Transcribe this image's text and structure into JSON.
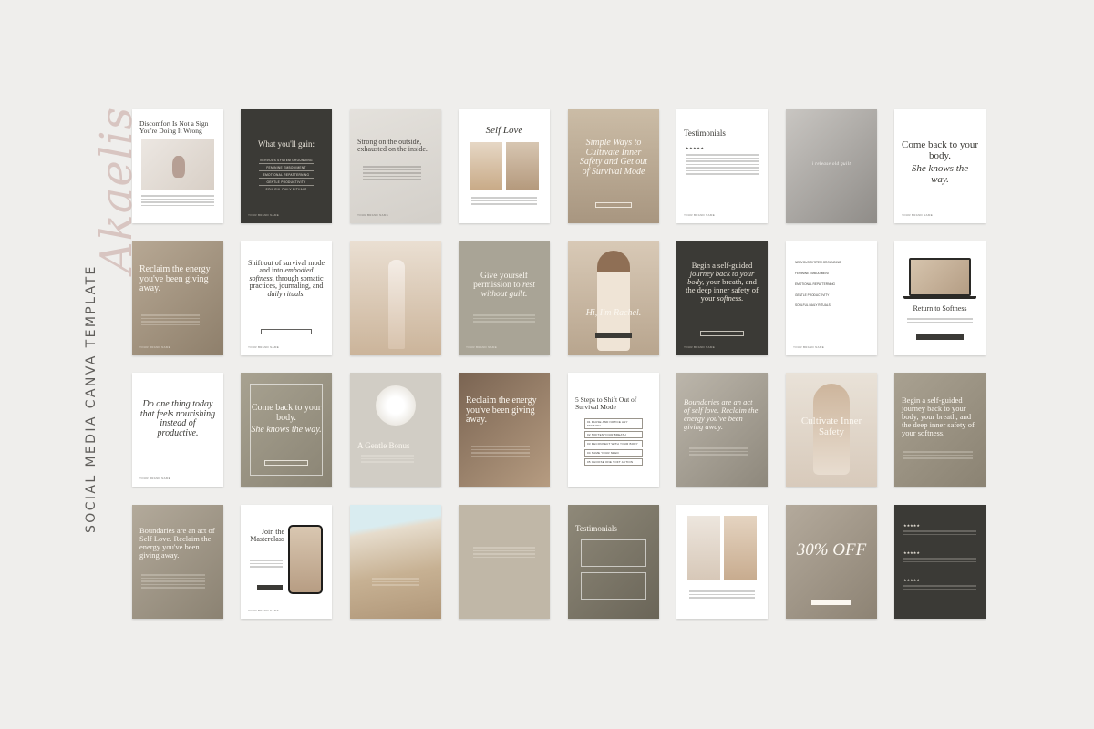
{
  "sidebar": {
    "script_title": "Akaelis",
    "vertical_title": "SOCIAL MEDIA CANVA TEMPLATE"
  },
  "colors": {
    "background": "#efeeec",
    "dark": "#3b3a36",
    "taupe": "#a9a496",
    "sand": "#c9bfae",
    "white": "#ffffff"
  },
  "cards": {
    "r1c1": {
      "title": "Discomfort Is Not a Sign You're Doing It Wrong"
    },
    "r1c2": {
      "title": "What you'll gain:",
      "items": [
        "NERVOUS SYSTEM GROUNDING",
        "FEMININE EMBODIMENT",
        "EMOTIONAL REPATTERNING",
        "GENTLE PRODUCTIVITY",
        "SOULFUL DAILY RITUALS"
      ],
      "footer": "YOUR BRAND NAME"
    },
    "r1c3": {
      "title": "Strong on the outside, exhausted on the inside.",
      "footer": "YOUR BRAND NAME"
    },
    "r1c4": {
      "title": "Self Love"
    },
    "r1c5": {
      "title": "Simple Ways to Cultivate Inner Safety and Get out of Survival Mode"
    },
    "r1c6": {
      "title": "Testimonials",
      "footer": "YOUR BRAND NAME"
    },
    "r1c7": {
      "title": "i release old guilt"
    },
    "r1c8": {
      "title_plain": "Come back to your body.",
      "title_italic": "She knows the way.",
      "footer": "YOUR BRAND NAME"
    },
    "r2c1": {
      "title": "Reclaim the energy you've been giving away.",
      "footer": "YOUR BRAND NAME"
    },
    "r2c2": {
      "title_plain": "Shift out of survival mode and into",
      "title_italic": "embodied softness,",
      "title_rest": "through somatic practices, journaling, and",
      "title_italic2": "daily rituals.",
      "footer": "YOUR BRAND NAME"
    },
    "r2c3": {
      "title": ""
    },
    "r2c4": {
      "title_plain": "Give yourself permission to",
      "title_italic": "rest without guilt.",
      "footer": "YOUR BRAND NAME"
    },
    "r2c5": {
      "title": "Hi, I'm Rachel."
    },
    "r2c6": {
      "title_plain": "Begin a self-guided",
      "title_italic": "journey back to your body,",
      "title_rest": "your breath, and the deep inner safety of your",
      "title_italic2": "softness.",
      "footer": "YOUR BRAND NAME"
    },
    "r2c7": {
      "items": [
        "NERVOUS SYSTEM GROUNDING",
        "FEMININE EMBODIMENT",
        "EMOTIONAL REPATTERNING",
        "GENTLE PRODUCTIVITY",
        "SOULFUL DAILY RITUALS"
      ],
      "footer": "YOUR BRAND NAME"
    },
    "r2c8": {
      "title": "Return to Softness"
    },
    "r3c1": {
      "title": "Do one thing today that feels nourishing instead of productive.",
      "footer": "YOUR BRAND NAME"
    },
    "r3c2": {
      "title_plain": "Come back to your body.",
      "title_italic": "She knows the way."
    },
    "r3c3": {
      "title": "A Gentle Bonus"
    },
    "r3c4": {
      "title": "Reclaim the energy you've been giving away."
    },
    "r3c5": {
      "title": "5 Steps to Shift Out of Survival Mode",
      "steps": [
        "01  PAUSE AND NOTICE ANY TENSION",
        "02  SOFTEN YOUR BREATH",
        "03  RECONNECT WITH YOUR BODY",
        "04  NAME YOUR NEED",
        "05  CHOOSE ONE SOFT ACTION"
      ]
    },
    "r3c6": {
      "title": "Boundaries are an act of self love. Reclaim the energy you've been giving away."
    },
    "r3c7": {
      "title": "Cultivate Inner Safety"
    },
    "r3c8": {
      "title": "Begin a self-guided journey back to your body, your breath, and the deep inner safety of your softness."
    },
    "r4c1": {
      "title": "Boundaries are an act of Self Love. Reclaim the energy you've been giving away."
    },
    "r4c2": {
      "title": "Join the Masterclass",
      "footer": "YOUR BRAND NAME"
    },
    "r4c3": {
      "title": ""
    },
    "r4c4": {
      "title": ""
    },
    "r4c5": {
      "title": "Testimonials"
    },
    "r4c6": {
      "title": ""
    },
    "r4c7": {
      "title": "30% OFF"
    },
    "r4c8": {
      "title": ""
    }
  }
}
